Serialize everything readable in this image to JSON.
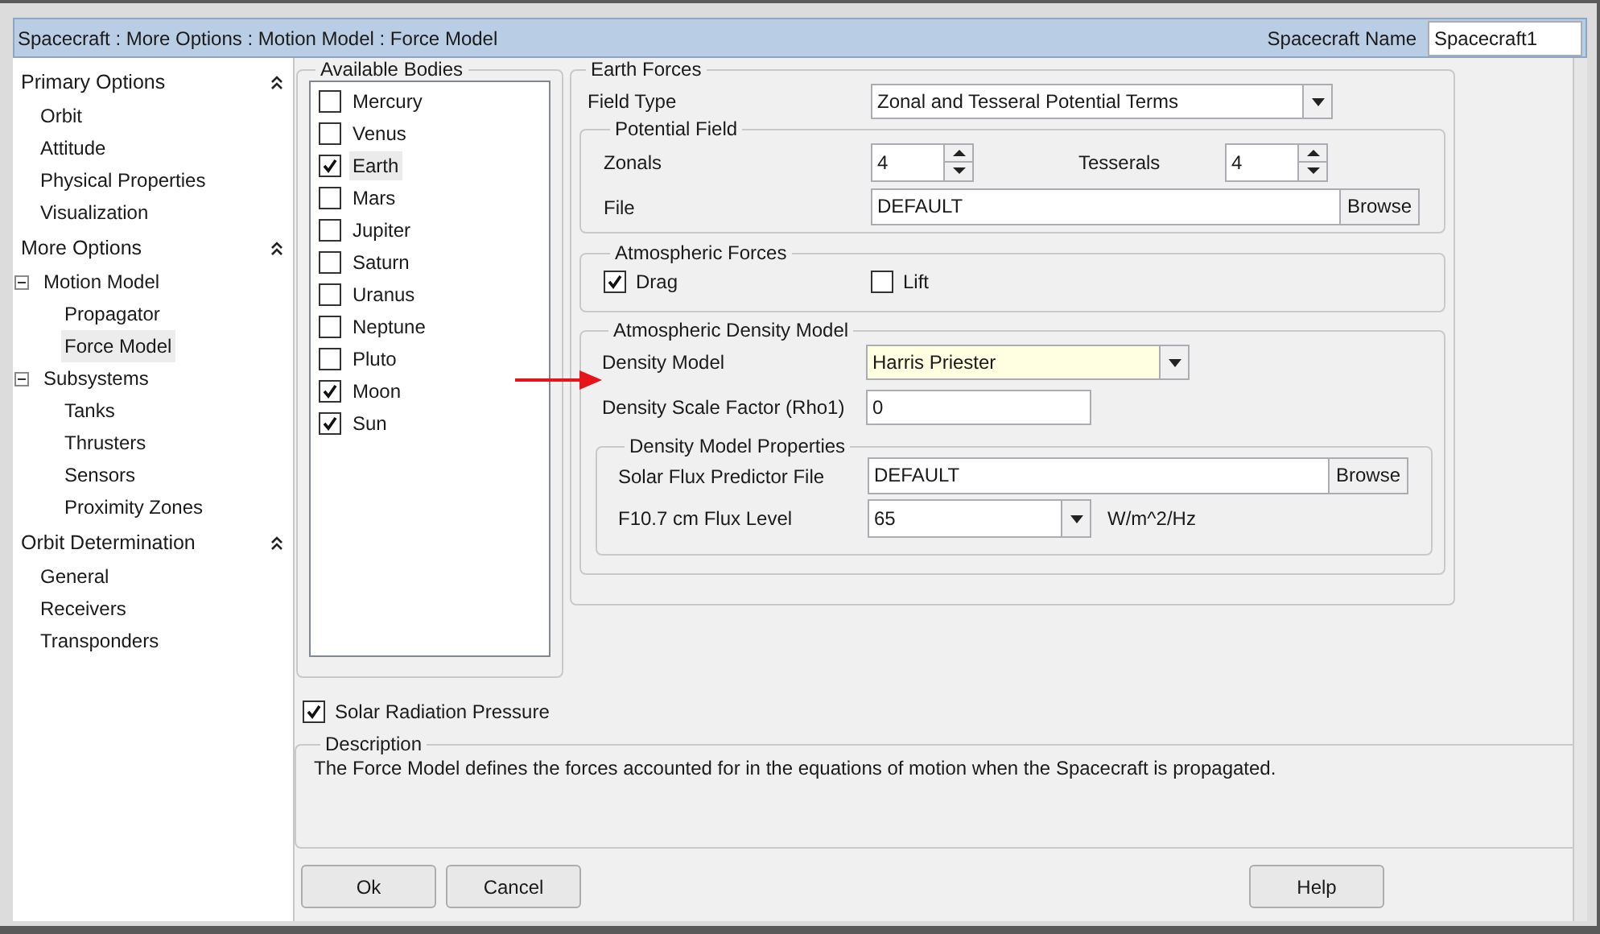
{
  "title": "Spacecraft : More Options : Motion Model : Force Model",
  "spacecraft_name": {
    "label": "Spacecraft Name",
    "value": "Spacecraft1"
  },
  "sidebar": {
    "sections": [
      {
        "label": "Primary Options",
        "expanded": true,
        "items": [
          {
            "label": "Orbit",
            "selected": false
          },
          {
            "label": "Attitude",
            "selected": false
          },
          {
            "label": "Physical Properties",
            "selected": false
          },
          {
            "label": "Visualization",
            "selected": false
          }
        ]
      },
      {
        "label": "More Options",
        "expanded": true,
        "items": [
          {
            "label": "Motion Model",
            "selected": false,
            "expanded": true,
            "children": [
              {
                "label": "Propagator",
                "selected": false
              },
              {
                "label": "Force Model",
                "selected": true
              }
            ]
          },
          {
            "label": "Subsystems",
            "selected": false,
            "expanded": true,
            "children": [
              {
                "label": "Tanks",
                "selected": false
              },
              {
                "label": "Thrusters",
                "selected": false
              },
              {
                "label": "Sensors",
                "selected": false
              },
              {
                "label": "Proximity Zones",
                "selected": false
              }
            ]
          }
        ]
      },
      {
        "label": "Orbit Determination",
        "expanded": true,
        "items": [
          {
            "label": "General",
            "selected": false
          },
          {
            "label": "Receivers",
            "selected": false
          },
          {
            "label": "Transponders",
            "selected": false
          }
        ]
      }
    ]
  },
  "available_bodies": {
    "title": "Available Bodies",
    "items": [
      {
        "name": "Mercury",
        "checked": false,
        "selected": false
      },
      {
        "name": "Venus",
        "checked": false,
        "selected": false
      },
      {
        "name": "Earth",
        "checked": true,
        "selected": true
      },
      {
        "name": "Mars",
        "checked": false,
        "selected": false
      },
      {
        "name": "Jupiter",
        "checked": false,
        "selected": false
      },
      {
        "name": "Saturn",
        "checked": false,
        "selected": false
      },
      {
        "name": "Uranus",
        "checked": false,
        "selected": false
      },
      {
        "name": "Neptune",
        "checked": false,
        "selected": false
      },
      {
        "name": "Pluto",
        "checked": false,
        "selected": false
      },
      {
        "name": "Moon",
        "checked": true,
        "selected": false
      },
      {
        "name": "Sun",
        "checked": true,
        "selected": false
      }
    ]
  },
  "earth_forces": {
    "title": "Earth Forces",
    "field_type": {
      "label": "Field Type",
      "value": "Zonal and Tesseral Potential Terms"
    },
    "potential_field": {
      "title": "Potential Field",
      "zonals": {
        "label": "Zonals",
        "value": "4"
      },
      "tesserals": {
        "label": "Tesserals",
        "value": "4"
      },
      "file": {
        "label": "File",
        "value": "DEFAULT",
        "button": "Browse"
      }
    },
    "atmospheric_forces": {
      "title": "Atmospheric Forces",
      "options": [
        {
          "label": "Drag",
          "checked": true
        },
        {
          "label": "Lift",
          "checked": false
        }
      ]
    },
    "atmospheric_density_model": {
      "title": "Atmospheric Density Model",
      "density_model": {
        "label": "Density Model",
        "value": "Harris Priester",
        "highlighted": true
      },
      "scale_factor": {
        "label": "Density Scale Factor (Rho1)",
        "value": "0"
      },
      "properties": {
        "title": "Density Model Properties",
        "predictor_file": {
          "label": "Solar Flux Predictor File",
          "value": "DEFAULT",
          "button": "Browse"
        },
        "flux_level": {
          "label": "F10.7 cm Flux Level",
          "value": "65",
          "unit": "W/m^2/Hz"
        }
      }
    }
  },
  "solar_radiation_pressure": {
    "label": "Solar Radiation Pressure",
    "checked": true
  },
  "description": {
    "title": "Description",
    "text": "The Force Model defines the forces accounted for in the equations of motion when the Spacecraft is propagated."
  },
  "buttons": [
    {
      "label": "Ok",
      "kind": "left"
    },
    {
      "label": "Cancel",
      "kind": "left"
    },
    {
      "label": "Help",
      "kind": "right"
    }
  ]
}
